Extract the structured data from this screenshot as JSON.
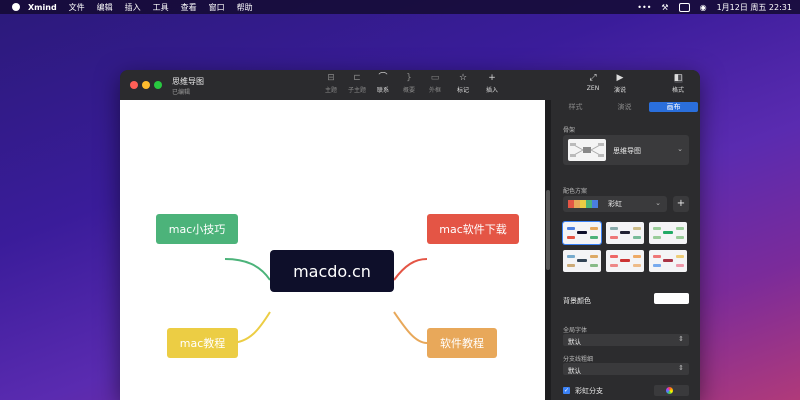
{
  "menubar": {
    "app": "Xmind",
    "items": [
      "文件",
      "编辑",
      "插入",
      "工具",
      "查看",
      "窗口",
      "帮助"
    ],
    "clock": "1月12日 周五 22:31"
  },
  "window": {
    "title": "思维导图",
    "subtitle": "已编辑",
    "toolbar": {
      "topic": "主题",
      "subtopic": "子主题",
      "relation": "联系",
      "summary": "概要",
      "boundary": "外框",
      "marker": "标记",
      "insert": "插入",
      "zen": "ZEN",
      "present": "演说",
      "format": "格式"
    }
  },
  "mindmap": {
    "central": "macdo.cn",
    "nodes": [
      {
        "label": "mac小技巧",
        "color": "#4cb37a"
      },
      {
        "label": "mac软件下载",
        "color": "#e45545"
      },
      {
        "label": "mac教程",
        "color": "#eccd44"
      },
      {
        "label": "软件教程",
        "color": "#e8a85a"
      }
    ],
    "branch_colors": [
      "#4cb37a",
      "#e45545",
      "#eccd44",
      "#e8a85a"
    ],
    "central_color": "#0e0f2a"
  },
  "panel": {
    "tabs": [
      "样式",
      "演说",
      "画布"
    ],
    "active_tab": "画布",
    "structure_label": "骨架",
    "structure_value": "思维导图",
    "color_scheme_label": "配色方案",
    "color_scheme_value": "彩虹",
    "bg_color_label": "背景颜色",
    "global_font_label": "全局字体",
    "global_font_value": "默认",
    "branch_width_label": "分支线粗细",
    "branch_width_value": "默认",
    "rainbow_branch_label": "彩虹分支",
    "rainbow_branch_checked": true
  }
}
